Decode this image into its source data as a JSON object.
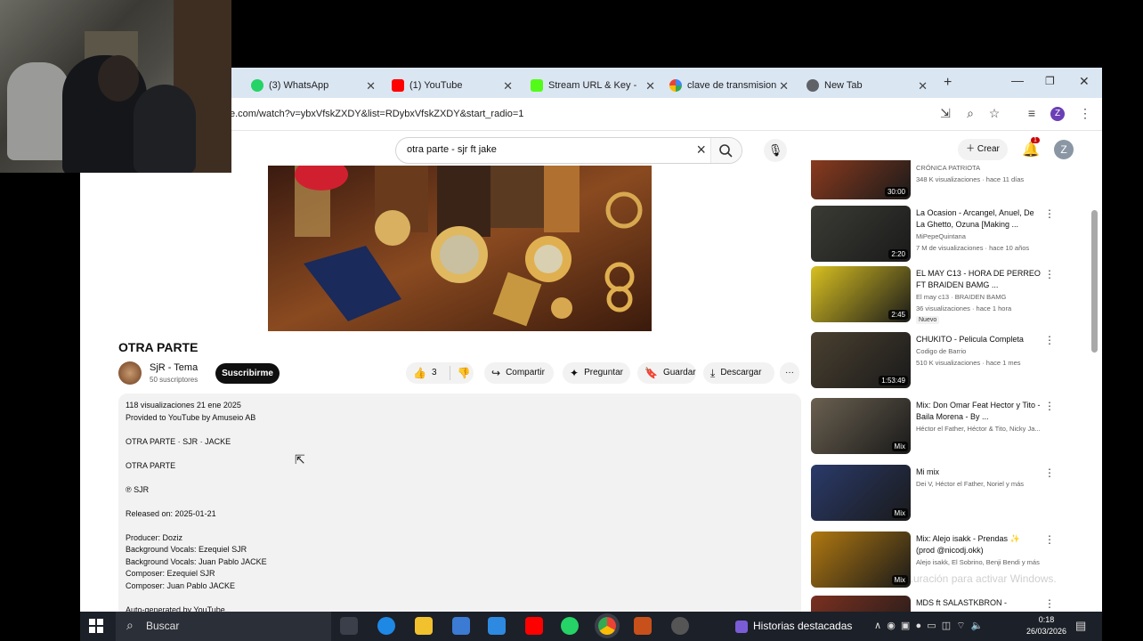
{
  "browser": {
    "tabs": [
      {
        "label": "(3) WhatsApp",
        "icon": "whatsapp-icon",
        "color": "#25d366"
      },
      {
        "label": "(1) YouTube",
        "icon": "youtube-icon",
        "color": "#ff0000"
      },
      {
        "label": "Stream URL & Key - ",
        "icon": "kick-icon",
        "color": "#53fc18"
      },
      {
        "label": "clave de transmision",
        "icon": "google-icon",
        "color": "#4285f4"
      },
      {
        "label": "New Tab",
        "icon": "chrome-icon",
        "color": "#5f6368"
      }
    ],
    "new_tab": "+",
    "url": "e.com/watch?v=ybxVfskZXDY&list=RDybxVfskZXDY&start_radio=1",
    "profile_initial": "Z"
  },
  "youtube": {
    "search_query": "otra parte - sjr ft jake",
    "create_label": "Crear",
    "notif_count": "1",
    "avatar_initial": "Z",
    "video": {
      "title": "OTRA PARTE",
      "channel": "SjR - Tema",
      "subscribers": "50 suscriptores",
      "subscribe": "Suscribirme",
      "likes": "3",
      "share": "Compartir",
      "ask": "Preguntar",
      "save": "Guardar",
      "download": "Descargar",
      "more": "···"
    },
    "description": [
      "118 visualizaciones  21 ene 2025",
      "Provided to YouTube by Amuseio AB",
      "",
      "OTRA PARTE · SJR · JACKE",
      "",
      "OTRA PARTE",
      "",
      "℗ SJR",
      "",
      "Released on: 2025-01-21",
      "",
      "Producer: Doziz",
      "Background  Vocals: Ezequiel SJR",
      "Background  Vocals: Juan Pablo JACKE",
      "Composer: Ezequiel SJR",
      "Composer: Juan Pablo JACKE",
      "",
      "Auto-generated by YouTube."
    ],
    "recommendations": [
      {
        "title": "",
        "channel": "CRÓNICA PATRIOTA",
        "meta": "348 K visualizaciones · hace 11 días",
        "duration": "30:00",
        "thumb": "#8a3a1e"
      },
      {
        "title": "La Ocasion - Arcangel, Anuel, De La Ghetto, Ozuna [Making ...",
        "channel": "MiPepeQuintana",
        "meta": "7 M de visualizaciones · hace 10 años",
        "duration": "2:20",
        "thumb": "#3b3b35"
      },
      {
        "title": "EL MAY C13 - HORA DE PERREO FT BRAIDEN BAMG ...",
        "channel": "El may c13 · BRAIDEN BAMG",
        "meta": "36 visualizaciones · hace 1 hora",
        "duration": "2:45",
        "thumb": "#d8c020",
        "badge": "Nuevo"
      },
      {
        "title": "CHUKITO - Pelicula Completa",
        "channel": "Codigo de Barrio",
        "meta": "510 K visualizaciones · hace 1 mes",
        "duration": "1:53:49",
        "thumb": "#4a4030"
      },
      {
        "title": "Mix: Don Omar Feat Hector y Tito - Baila Morena - By ...",
        "channel": "Héctor el Father, Héctor & Tito, Nicky Ja...",
        "meta": "",
        "duration": "Mix",
        "thumb": "#6a6050"
      },
      {
        "title": "Mi mix",
        "channel": "Dei V, Héctor el Father, Noriel y más",
        "meta": "",
        "duration": "Mix",
        "thumb": "#2a3a6a"
      },
      {
        "title": "Mix: Alejo isakk - Prendas ✨ (prod @nicodj.okk)",
        "channel": "Alejo isakk, El Sobrino, Benji Bendi y más",
        "meta": "",
        "duration": "Mix",
        "thumb": "#b07810"
      },
      {
        "title": "MDS ft SALASTKBRON -",
        "channel": "",
        "meta": "",
        "duration": "",
        "thumb": "#7a3020"
      }
    ],
    "watermark": "...uración para activar Windows."
  },
  "taskbar": {
    "search_label": "Buscar",
    "widgets_label": "Historias destacadas",
    "time": "0:18",
    "date": "26/03/2026"
  },
  "colors": {
    "tabbar": "#dbe6f3",
    "youtube_red": "#ff0000",
    "taskbar": "#1c2028"
  }
}
